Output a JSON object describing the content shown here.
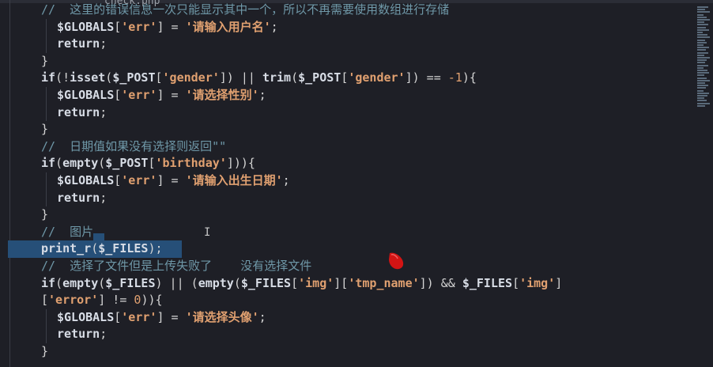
{
  "editor": {
    "tab_fragment": "check.php",
    "lines": [
      {
        "indent": 1,
        "tokens": [
          [
            "com",
            "//  这里的错误信息一次只能显示其中一个，所以不再需要使用数组进行存储"
          ]
        ]
      },
      {
        "indent": 2,
        "tokens": [
          [
            "var",
            "$GLOBALS"
          ],
          [
            "op",
            "["
          ],
          [
            "str",
            "'err'"
          ],
          [
            "op",
            "] = "
          ],
          [
            "str",
            "'请输入用户名'"
          ],
          [
            "op",
            ";"
          ]
        ]
      },
      {
        "indent": 2,
        "tokens": [
          [
            "kw",
            "return"
          ],
          [
            "op",
            ";"
          ]
        ]
      },
      {
        "indent": 1,
        "tokens": [
          [
            "op",
            "}"
          ]
        ]
      },
      {
        "indent": 1,
        "tokens": [
          [
            "kw",
            "if"
          ],
          [
            "op",
            "(!"
          ],
          [
            "fn",
            "isset"
          ],
          [
            "op",
            "("
          ],
          [
            "var",
            "$_POST"
          ],
          [
            "op",
            "["
          ],
          [
            "str",
            "'gender'"
          ],
          [
            "op",
            "]) || "
          ],
          [
            "fn",
            "trim"
          ],
          [
            "op",
            "("
          ],
          [
            "var",
            "$_POST"
          ],
          [
            "op",
            "["
          ],
          [
            "str",
            "'gender'"
          ],
          [
            "op",
            "]) == "
          ],
          [
            "num",
            "-1"
          ],
          [
            "op",
            "){"
          ]
        ]
      },
      {
        "indent": 2,
        "tokens": [
          [
            "var",
            "$GLOBALS"
          ],
          [
            "op",
            "["
          ],
          [
            "str",
            "'err'"
          ],
          [
            "op",
            "] = "
          ],
          [
            "str",
            "'请选择性别'"
          ],
          [
            "op",
            ";"
          ]
        ]
      },
      {
        "indent": 2,
        "tokens": [
          [
            "kw",
            "return"
          ],
          [
            "op",
            ";"
          ]
        ]
      },
      {
        "indent": 1,
        "tokens": [
          [
            "op",
            "}"
          ]
        ]
      },
      {
        "indent": 1,
        "tokens": [
          [
            "com",
            "//  日期值如果没有选择则返回\"\""
          ]
        ]
      },
      {
        "indent": 1,
        "tokens": [
          [
            "kw",
            "if"
          ],
          [
            "op",
            "("
          ],
          [
            "fn",
            "empty"
          ],
          [
            "op",
            "("
          ],
          [
            "var",
            "$_POST"
          ],
          [
            "op",
            "["
          ],
          [
            "str",
            "'birthday'"
          ],
          [
            "op",
            "])){"
          ]
        ]
      },
      {
        "indent": 2,
        "tokens": [
          [
            "var",
            "$GLOBALS"
          ],
          [
            "op",
            "["
          ],
          [
            "str",
            "'err'"
          ],
          [
            "op",
            "] = "
          ],
          [
            "str",
            "'请输入出生日期'"
          ],
          [
            "op",
            ";"
          ]
        ]
      },
      {
        "indent": 2,
        "tokens": [
          [
            "kw",
            "return"
          ],
          [
            "op",
            ";"
          ]
        ]
      },
      {
        "indent": 1,
        "tokens": [
          [
            "op",
            "}"
          ]
        ]
      },
      {
        "indent": 1,
        "tokens": [
          [
            "com",
            "//  图片"
          ]
        ]
      },
      {
        "indent": 1,
        "tokens": [
          [
            "fn",
            "print_r"
          ],
          [
            "op",
            "("
          ],
          [
            "var",
            "$_FILES"
          ],
          [
            "op",
            ");"
          ]
        ]
      },
      {
        "indent": 1,
        "tokens": [
          [
            "com",
            "//  选择了文件但是上传失败了    没有选择文件"
          ]
        ]
      },
      {
        "indent": 1,
        "tokens": [
          [
            "kw",
            "if"
          ],
          [
            "op",
            "("
          ],
          [
            "fn",
            "empty"
          ],
          [
            "op",
            "("
          ],
          [
            "var",
            "$_FILES"
          ],
          [
            "op",
            ") || ("
          ],
          [
            "fn",
            "empty"
          ],
          [
            "op",
            "("
          ],
          [
            "var",
            "$_FILES"
          ],
          [
            "op",
            "["
          ],
          [
            "str",
            "'img'"
          ],
          [
            "op",
            "]["
          ],
          [
            "str",
            "'tmp_name'"
          ],
          [
            "op",
            "]) && "
          ],
          [
            "var",
            "$_FILES"
          ],
          [
            "op",
            "["
          ],
          [
            "str",
            "'img'"
          ],
          [
            "op",
            "]"
          ]
        ]
      },
      {
        "indent": 0,
        "tokens": [
          [
            "op",
            "["
          ],
          [
            "str",
            "'error'"
          ],
          [
            "op",
            "] != "
          ],
          [
            "num",
            "0"
          ],
          [
            "op",
            ")){"
          ]
        ]
      },
      {
        "indent": 2,
        "tokens": [
          [
            "var",
            "$GLOBALS"
          ],
          [
            "op",
            "["
          ],
          [
            "str",
            "'err'"
          ],
          [
            "op",
            "] = "
          ],
          [
            "str",
            "'请选择头像'"
          ],
          [
            "op",
            ";"
          ]
        ]
      },
      {
        "indent": 2,
        "tokens": [
          [
            "kw",
            "return"
          ],
          [
            "op",
            ";"
          ]
        ]
      },
      {
        "indent": 1,
        "tokens": [
          [
            "op",
            "}"
          ]
        ]
      }
    ],
    "selected_lines": [
      13,
      14
    ],
    "cursor_glyph": "I"
  }
}
